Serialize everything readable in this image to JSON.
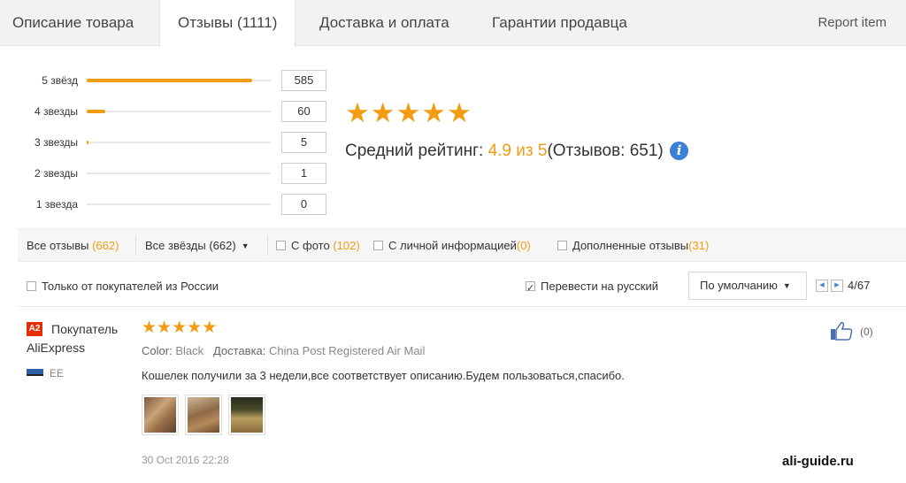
{
  "tabs": {
    "description": "Описание товара",
    "reviews": "Отзывы (1111)",
    "delivery": "Доставка и оплата",
    "guarantees": "Гарантии продавца",
    "report": "Report item"
  },
  "histogram": [
    {
      "label": "5 звёзд",
      "count": "585",
      "fraction": 0.9
    },
    {
      "label": "4 звезды",
      "count": "60",
      "fraction": 0.1
    },
    {
      "label": "3 звезды",
      "count": "5",
      "fraction": 0.01
    },
    {
      "label": "2 звезды",
      "count": "1",
      "fraction": 0.0
    },
    {
      "label": "1 звезда",
      "count": "0",
      "fraction": 0.0
    }
  ],
  "summary": {
    "stars": "★★★★★",
    "avg_label": "Средний рейтинг:",
    "avg_value": "4.9 из 5",
    "reviews_count": "(Отзывов: 651)",
    "info_glyph": "i",
    "star_color": "#f39c12"
  },
  "filters": {
    "all_reviews": {
      "label": "Все отзывы",
      "count": "(662)"
    },
    "all_stars": {
      "label": "Все звёзды (662)"
    },
    "with_photo": {
      "label": "С фото",
      "count": "(102)",
      "checked": false
    },
    "personal_info": {
      "label": "С личной информацией",
      "count": "(0)",
      "checked": false
    },
    "additional": {
      "label": "Дополненные отзывы",
      "count": "(31)",
      "checked": false
    }
  },
  "options": {
    "russia_only": {
      "label": "Только от покупателей из России",
      "checked": false
    },
    "translate": {
      "label": "Перевести на русский",
      "checked": true
    },
    "sort": "По умолчанию",
    "page": "4/67"
  },
  "review": {
    "badge": "A2",
    "buyer": "Покупатель AliExpress",
    "country": "EE",
    "stars": "★★★★★",
    "color_key": "Color:",
    "color_val": "Black",
    "delivery_key": "Доставка:",
    "delivery_val": "China Post Registered Air Mail",
    "text": "Кошелек получили за 3 недели,все соответствует описанию.Будем пользоваться,спасибо.",
    "date": "30 Oct 2016 22:28",
    "likes": "(0)",
    "photos": 3
  },
  "watermark": "ali-guide.ru"
}
